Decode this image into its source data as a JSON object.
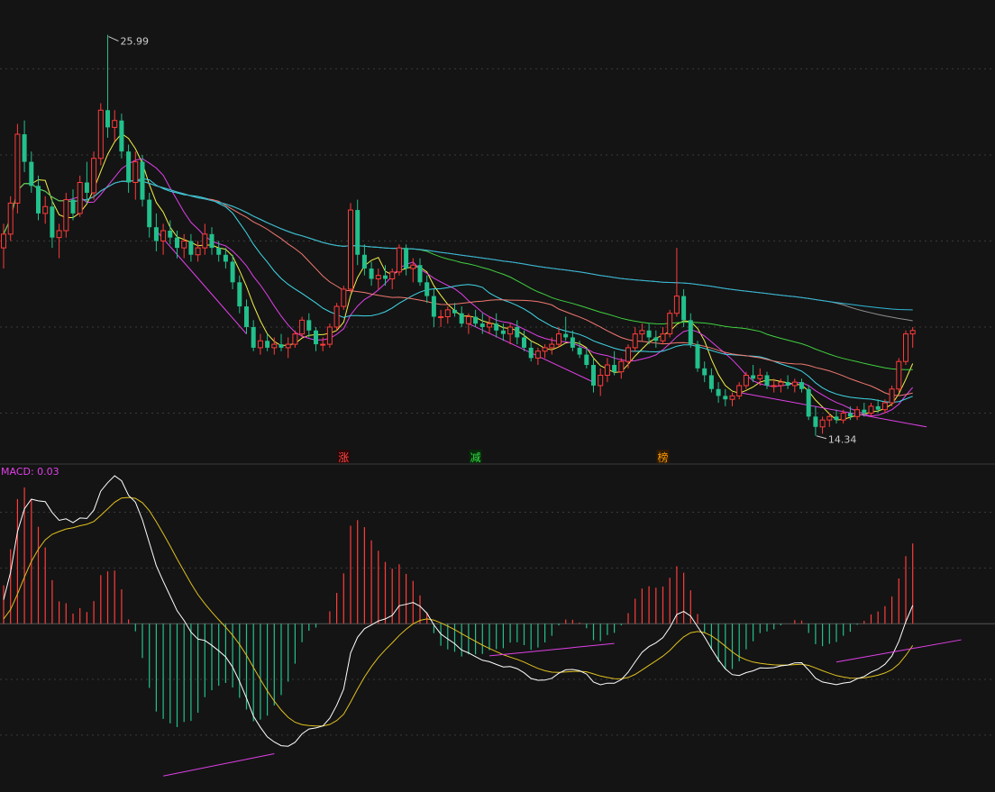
{
  "chart_data": [
    {
      "type": "candlestick",
      "panel": "price",
      "ylim": [
        13.6,
        27.0
      ],
      "gridlines": [
        25.0,
        22.5,
        20.0,
        17.5,
        15.0
      ],
      "highlights": {
        "high": {
          "label": "25.99",
          "value": 25.99
        },
        "low": {
          "label": "14.34",
          "value": 14.34
        }
      },
      "candles": [
        [
          19.8,
          20.5,
          19.2,
          20.2
        ],
        [
          20.2,
          21.3,
          20.0,
          21.1
        ],
        [
          21.1,
          23.4,
          20.8,
          23.1
        ],
        [
          23.1,
          23.5,
          22.0,
          22.3
        ],
        [
          22.3,
          22.6,
          21.4,
          21.6
        ],
        [
          21.6,
          21.9,
          20.6,
          20.8
        ],
        [
          20.8,
          21.3,
          20.5,
          21.0
        ],
        [
          21.0,
          21.2,
          19.8,
          20.1
        ],
        [
          20.1,
          20.5,
          19.5,
          20.3
        ],
        [
          20.3,
          21.4,
          20.1,
          21.2
        ],
        [
          21.2,
          21.5,
          20.6,
          20.8
        ],
        [
          20.8,
          21.9,
          20.7,
          21.7
        ],
        [
          21.7,
          22.3,
          21.1,
          21.4
        ],
        [
          21.4,
          22.6,
          21.2,
          22.4
        ],
        [
          22.4,
          24.0,
          22.2,
          23.8
        ],
        [
          23.8,
          25.99,
          23.0,
          23.3
        ],
        [
          23.3,
          23.8,
          22.9,
          23.5
        ],
        [
          23.5,
          23.7,
          22.4,
          22.6
        ],
        [
          22.6,
          22.8,
          21.4,
          21.7
        ],
        [
          21.7,
          22.6,
          21.2,
          22.3
        ],
        [
          22.3,
          22.5,
          21.0,
          21.2
        ],
        [
          21.2,
          21.4,
          20.1,
          20.4
        ],
        [
          20.4,
          20.8,
          19.7,
          20.0
        ],
        [
          20.0,
          20.5,
          19.6,
          20.3
        ],
        [
          20.3,
          20.6,
          19.9,
          20.1
        ],
        [
          20.1,
          20.3,
          19.5,
          19.8
        ],
        [
          19.8,
          20.2,
          19.5,
          20.0
        ],
        [
          20.0,
          20.2,
          19.4,
          19.6
        ],
        [
          19.6,
          20.0,
          19.4,
          19.8
        ],
        [
          19.8,
          20.5,
          19.6,
          20.2
        ],
        [
          20.2,
          20.4,
          19.6,
          19.8
        ],
        [
          19.8,
          20.0,
          19.4,
          19.6
        ],
        [
          19.6,
          19.8,
          19.2,
          19.4
        ],
        [
          19.4,
          19.6,
          18.6,
          18.8
        ],
        [
          18.8,
          19.0,
          17.9,
          18.1
        ],
        [
          18.1,
          18.3,
          17.3,
          17.5
        ],
        [
          17.5,
          17.7,
          16.8,
          16.9
        ],
        [
          16.9,
          17.3,
          16.7,
          17.1
        ],
        [
          17.1,
          17.3,
          16.8,
          16.9
        ],
        [
          16.9,
          17.2,
          16.7,
          17.0
        ],
        [
          17.0,
          17.3,
          16.8,
          16.9
        ],
        [
          16.9,
          17.2,
          16.6,
          17.0
        ],
        [
          17.0,
          17.4,
          16.9,
          17.3
        ],
        [
          17.3,
          17.8,
          17.2,
          17.7
        ],
        [
          17.7,
          17.9,
          17.2,
          17.4
        ],
        [
          17.4,
          17.5,
          16.8,
          17.0
        ],
        [
          17.0,
          17.2,
          16.8,
          17.0
        ],
        [
          17.0,
          17.6,
          16.9,
          17.5
        ],
        [
          17.5,
          18.2,
          17.4,
          18.1
        ],
        [
          18.1,
          18.7,
          18.0,
          18.6
        ],
        [
          18.6,
          21.1,
          18.5,
          20.9
        ],
        [
          20.9,
          21.2,
          19.3,
          19.6
        ],
        [
          19.6,
          19.9,
          19.0,
          19.2
        ],
        [
          19.2,
          19.4,
          18.7,
          18.9
        ],
        [
          18.9,
          19.2,
          18.6,
          19.0
        ],
        [
          19.0,
          19.3,
          18.7,
          18.9
        ],
        [
          18.9,
          19.2,
          18.6,
          19.1
        ],
        [
          19.1,
          19.9,
          19.0,
          19.8
        ],
        [
          19.8,
          19.9,
          19.0,
          19.2
        ],
        [
          19.2,
          19.5,
          18.8,
          19.3
        ],
        [
          19.3,
          19.5,
          18.7,
          18.8
        ],
        [
          18.8,
          19.0,
          18.2,
          18.4
        ],
        [
          18.4,
          18.6,
          17.5,
          17.8
        ],
        [
          17.8,
          18.0,
          17.5,
          17.8
        ],
        [
          17.8,
          18.1,
          17.6,
          18.0
        ],
        [
          18.0,
          18.2,
          17.8,
          17.9
        ],
        [
          17.9,
          18.1,
          17.5,
          17.6
        ],
        [
          17.6,
          17.9,
          17.3,
          17.8
        ],
        [
          17.8,
          18.0,
          17.5,
          17.6
        ],
        [
          17.6,
          17.9,
          17.3,
          17.5
        ],
        [
          17.5,
          17.8,
          17.3,
          17.6
        ],
        [
          17.6,
          17.9,
          17.2,
          17.4
        ],
        [
          17.4,
          17.6,
          17.1,
          17.3
        ],
        [
          17.3,
          17.6,
          17.0,
          17.5
        ],
        [
          17.5,
          17.7,
          17.0,
          17.2
        ],
        [
          17.2,
          17.4,
          16.8,
          16.9
        ],
        [
          16.9,
          17.1,
          16.5,
          16.6
        ],
        [
          16.6,
          16.9,
          16.4,
          16.8
        ],
        [
          16.8,
          17.0,
          16.6,
          16.9
        ],
        [
          16.9,
          17.2,
          16.7,
          17.0
        ],
        [
          17.0,
          17.5,
          16.9,
          17.3
        ],
        [
          17.3,
          17.8,
          17.1,
          17.2
        ],
        [
          17.2,
          17.4,
          16.8,
          16.9
        ],
        [
          16.9,
          17.1,
          16.6,
          16.7
        ],
        [
          16.7,
          16.9,
          16.3,
          16.4
        ],
        [
          16.4,
          16.6,
          15.6,
          15.8
        ],
        [
          15.8,
          16.3,
          15.5,
          16.1
        ],
        [
          16.1,
          16.6,
          15.9,
          16.4
        ],
        [
          16.4,
          16.8,
          16.1,
          16.2
        ],
        [
          16.2,
          16.6,
          16.0,
          16.5
        ],
        [
          16.5,
          17.0,
          16.3,
          16.9
        ],
        [
          16.9,
          17.5,
          16.8,
          17.3
        ],
        [
          17.3,
          17.6,
          17.1,
          17.4
        ],
        [
          17.4,
          17.6,
          17.0,
          17.2
        ],
        [
          17.2,
          17.4,
          16.9,
          17.1
        ],
        [
          17.1,
          17.5,
          17.0,
          17.3
        ],
        [
          17.3,
          18.0,
          17.2,
          17.9
        ],
        [
          17.9,
          19.8,
          17.8,
          18.4
        ],
        [
          18.4,
          18.6,
          17.5,
          17.7
        ],
        [
          17.7,
          17.9,
          16.9,
          17.0
        ],
        [
          17.0,
          17.1,
          16.2,
          16.3
        ],
        [
          16.3,
          16.5,
          15.9,
          16.1
        ],
        [
          16.1,
          16.3,
          15.6,
          15.7
        ],
        [
          15.7,
          15.9,
          15.3,
          15.5
        ],
        [
          15.5,
          15.7,
          15.2,
          15.4
        ],
        [
          15.4,
          15.6,
          15.2,
          15.5
        ],
        [
          15.5,
          15.9,
          15.4,
          15.8
        ],
        [
          15.8,
          16.2,
          15.7,
          16.1
        ],
        [
          16.1,
          16.4,
          15.9,
          16.0
        ],
        [
          16.0,
          16.3,
          15.8,
          16.1
        ],
        [
          16.1,
          16.2,
          15.7,
          15.8
        ],
        [
          15.8,
          16.0,
          15.6,
          15.8
        ],
        [
          15.8,
          16.0,
          15.6,
          15.9
        ],
        [
          15.9,
          16.1,
          15.7,
          15.8
        ],
        [
          15.8,
          16.0,
          15.6,
          15.9
        ],
        [
          15.9,
          16.0,
          15.6,
          15.7
        ],
        [
          15.7,
          15.8,
          14.8,
          14.9
        ],
        [
          14.9,
          15.2,
          14.34,
          14.6
        ],
        [
          14.6,
          14.9,
          14.4,
          14.8
        ],
        [
          14.8,
          15.0,
          14.6,
          14.9
        ],
        [
          14.9,
          15.1,
          14.7,
          14.8
        ],
        [
          14.8,
          15.1,
          14.7,
          15.0
        ],
        [
          15.0,
          15.2,
          14.8,
          14.9
        ],
        [
          14.9,
          15.2,
          14.8,
          15.1
        ],
        [
          15.1,
          15.3,
          14.9,
          15.0
        ],
        [
          15.0,
          15.3,
          14.9,
          15.2
        ],
        [
          15.2,
          15.4,
          15.0,
          15.1
        ],
        [
          15.1,
          15.4,
          15.0,
          15.3
        ],
        [
          15.3,
          15.8,
          15.2,
          15.7
        ],
        [
          15.7,
          16.6,
          15.6,
          16.5
        ],
        [
          16.5,
          17.4,
          16.4,
          17.3
        ],
        [
          17.3,
          17.5,
          16.9,
          17.4
        ]
      ],
      "moving_averages": [
        {
          "period": 5,
          "color": "#f0f048"
        },
        {
          "period": 10,
          "color": "#e040e8"
        },
        {
          "period": 20,
          "color": "#40d8e8"
        },
        {
          "period": 30,
          "color": "#f07870"
        },
        {
          "period": 60,
          "color": "#40d040"
        },
        {
          "period": 120,
          "color": "#909090"
        },
        {
          "period": 250,
          "color": "#30b8d8"
        }
      ],
      "trend_lines": [
        {
          "from": [
            20.3,
            22
          ],
          "to": [
            17.3,
            35
          ]
        },
        {
          "from": [
            17.6,
            67
          ],
          "to": [
            15.9,
            85
          ]
        },
        {
          "from": [
            15.6,
            106
          ],
          "to": [
            14.6,
            133
          ]
        }
      ],
      "markers": [
        {
          "label": "涨",
          "color": "#ff4444",
          "candle": 49
        },
        {
          "label": "减",
          "color": "#33dd44",
          "candle": 68
        },
        {
          "label": "榜",
          "color": "#ff9900",
          "candle": 95
        }
      ]
    },
    {
      "type": "macd",
      "panel": "indicator",
      "title": "MACD: 0.03",
      "ylim": [
        -1.33,
        1.18
      ],
      "gridlines": [
        0.9,
        0.45,
        -0.45,
        -0.9
      ],
      "series": [
        {
          "line": "DIF",
          "color": "#ffffff"
        },
        {
          "line": "DEA",
          "color": "#e0c020"
        },
        {
          "line": "MACD",
          "colors": {
            "positive": "#ff3b3b",
            "negative": "#22c08c"
          }
        }
      ],
      "divergence_lines": [
        {
          "from": [
            -1.23,
            23
          ],
          "to": [
            -1.05,
            39
          ]
        },
        {
          "from": [
            -0.26,
            70
          ],
          "to": [
            -0.16,
            88
          ]
        },
        {
          "from": [
            -0.31,
            120
          ],
          "to": [
            -0.13,
            138
          ]
        }
      ]
    }
  ]
}
